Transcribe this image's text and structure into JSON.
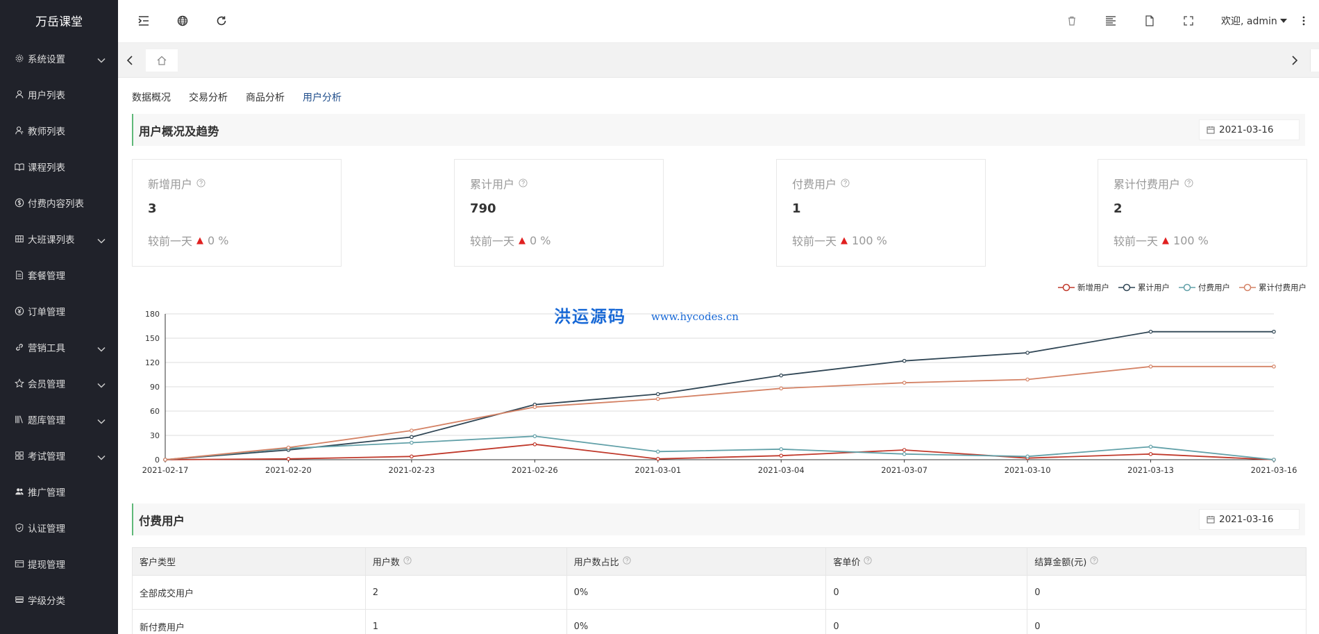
{
  "sidebar": {
    "brand": "万岳课堂",
    "items": [
      {
        "label": "系统设置",
        "icon": "gear-icon",
        "has_children": true
      },
      {
        "label": "用户列表",
        "icon": "user-icon",
        "has_children": false
      },
      {
        "label": "教师列表",
        "icon": "teacher-icon",
        "has_children": false
      },
      {
        "label": "课程列表",
        "icon": "book-icon",
        "has_children": false
      },
      {
        "label": "付费内容列表",
        "icon": "dollar-icon",
        "has_children": false
      },
      {
        "label": "大班课列表",
        "icon": "grid-icon",
        "has_children": true
      },
      {
        "label": "套餐管理",
        "icon": "document-icon",
        "has_children": false
      },
      {
        "label": "订单管理",
        "icon": "yen-icon",
        "has_children": false
      },
      {
        "label": "营销工具",
        "icon": "link-icon",
        "has_children": true
      },
      {
        "label": "会员管理",
        "icon": "star-icon",
        "has_children": true
      },
      {
        "label": "题库管理",
        "icon": "question-bank-icon",
        "has_children": true
      },
      {
        "label": "考试管理",
        "icon": "apps-icon",
        "has_children": true
      },
      {
        "label": "推广管理",
        "icon": "users-icon",
        "has_children": false
      },
      {
        "label": "认证管理",
        "icon": "shield-icon",
        "has_children": false
      },
      {
        "label": "提现管理",
        "icon": "wallet-icon",
        "has_children": false
      },
      {
        "label": "学级分类",
        "icon": "layers-icon",
        "has_children": false
      }
    ]
  },
  "header": {
    "welcome": "欢迎, admin"
  },
  "subtabs": [
    {
      "label": "数据概况",
      "active": false
    },
    {
      "label": "交易分析",
      "active": false
    },
    {
      "label": "商品分析",
      "active": false
    },
    {
      "label": "用户分析",
      "active": true
    }
  ],
  "overview": {
    "title": "用户概况及趋势",
    "date": "2021-03-16",
    "cards": [
      {
        "label": "新增用户",
        "value": "3",
        "compare_label": "较前一天",
        "compare_value": "0 %"
      },
      {
        "label": "累计用户",
        "value": "790",
        "compare_label": "较前一天",
        "compare_value": "0 %"
      },
      {
        "label": "付费用户",
        "value": "1",
        "compare_label": "较前一天",
        "compare_value": "100 %"
      },
      {
        "label": "累计付费用户",
        "value": "2",
        "compare_label": "较前一天",
        "compare_value": "100 %"
      }
    ]
  },
  "watermark": {
    "main": "洪运源码",
    "url": "www.hycodes.cn"
  },
  "chart_data": {
    "type": "line",
    "x": [
      "2021-02-17",
      "2021-02-20",
      "2021-02-23",
      "2021-02-26",
      "2021-03-01",
      "2021-03-04",
      "2021-03-07",
      "2021-03-10",
      "2021-03-13",
      "2021-03-16"
    ],
    "ylim": [
      0,
      180
    ],
    "yticks": [
      0,
      30,
      60,
      90,
      120,
      150,
      180
    ],
    "legend_position": "top-right",
    "grid": true,
    "series": [
      {
        "name": "新增用户",
        "color": "#c0392b",
        "values": [
          0,
          1,
          4,
          19,
          1,
          5,
          12,
          2,
          7,
          0
        ]
      },
      {
        "name": "累计用户",
        "color": "#2f4554",
        "values": [
          0,
          12,
          28,
          68,
          81,
          104,
          122,
          132,
          158,
          158
        ]
      },
      {
        "name": "付费用户",
        "color": "#61a0a8",
        "values": [
          0,
          14,
          21,
          29,
          10,
          13,
          7,
          4,
          16,
          0
        ]
      },
      {
        "name": "累计付费用户",
        "color": "#d48265",
        "values": [
          0,
          15,
          36,
          65,
          75,
          88,
          95,
          99,
          115,
          115
        ]
      }
    ]
  },
  "paid": {
    "title": "付费用户",
    "date": "2021-03-16",
    "columns": [
      "客户类型",
      "用户数",
      "用户数占比",
      "客单价",
      "结算金额(元)"
    ],
    "rows": [
      [
        "全部成交用户",
        "2",
        "0%",
        "0",
        "0"
      ],
      [
        "新付费用户",
        "1",
        "0%",
        "0",
        "0"
      ]
    ]
  }
}
